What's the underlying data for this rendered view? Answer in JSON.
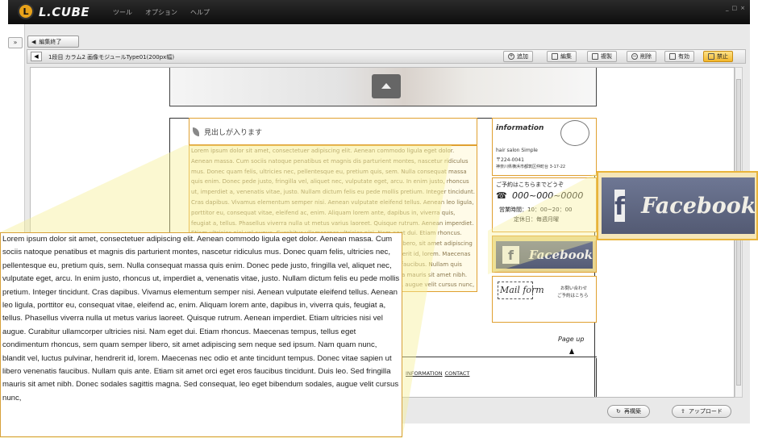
{
  "app": {
    "logo_text": "L.CUBE",
    "logo_mark": "L",
    "menu": [
      "ツール",
      "オプション",
      "ヘルプ"
    ],
    "win_controls": [
      "_",
      "□",
      "×"
    ]
  },
  "panel": {
    "expander": "»",
    "edit_end_label": "編集終了",
    "breadcrumb": "1段目 カラム2 画像モジュールType01(200px幅)",
    "buttons": {
      "add": "追加",
      "edit": "編集",
      "copy": "複製",
      "delete": "削除",
      "enable": "有効",
      "disable": "禁止"
    },
    "rebuild": "再構築",
    "upload": "アップロード"
  },
  "page": {
    "heading": "見出しが入ります",
    "body_text": "Lorem ipsum dolor sit amet, consectetuer adipiscing elit. Aenean commodo ligula eget dolor. Aenean massa. Cum sociis natoque penatibus et magnis dis parturient montes, nascetur ridiculus mus. Donec quam felis, ultricies nec, pellentesque eu, pretium quis, sem. Nulla consequat massa quis enim. Donec pede justo, fringilla vel, aliquet nec, vulputate eget, arcu. In enim justo, rhoncus ut, imperdiet a, venenatis vitae, justo. Nullam dictum felis eu pede mollis pretium. Integer tincidunt. Cras dapibus. Vivamus elementum semper nisi. Aenean vulputate eleifend tellus. Aenean leo ligula, porttitor eu, consequat vitae, eleifend ac, enim. Aliquam lorem ante, dapibus in, viverra quis, feugiat a, tellus. Phasellus viverra nulla ut metus varius laoreet. Quisque rutrum. Aenean imperdiet. Etiam ultricies nisi vel augue. Curabitur ullamcorper ultricies nisi. Nam eget dui. Etiam rhoncus. Maecenas tempus, tellus eget condimentum rhoncus, sem quam semper libero, sit amet adipiscing sem neque sed ipsum. Nam quam nunc, blandit vel, luctus pulvinar, hendrerit id, lorem. Maecenas nec odio et ante tincidunt tempus. Donec vitae sapien ut libero venenatis faucibus. Nullam quis ante. Etiam sit amet orci eget eros faucibus tincidunt. Duis leo. Sed fringilla mauris sit amet nibh. Donec sodales sagittis magna. Sed consequat, leo eget bibendum sodales, augue velit cursus nunc,",
    "info": {
      "title": "information",
      "salon": "hair salon Simple",
      "zip": "〒224-0041",
      "address": "神奈川県横浜市都筑区仲町台 3-17-22"
    },
    "reservation": {
      "title": "ご予約はこちらまでどうぞ",
      "phone": "000~000~0000",
      "hours": "営業時間：10：00~20：00",
      "holiday": "定休日：毎週月曜"
    },
    "facebook": "Facebook",
    "facebook_mark": "f",
    "mail": {
      "title": "Mail form",
      "note_line1": "お問い合わせ",
      "note_line2": "ご予約はこちら"
    },
    "page_up": "Page up",
    "footer_links": [
      "INFORMATION",
      "CONTACT"
    ]
  },
  "zoom": {
    "text": "Lorem ipsum dolor sit amet, consectetuer adipiscing elit. Aenean commodo ligula eget dolor. Aenean massa. Cum sociis natoque penatibus et magnis dis parturient montes, nascetur ridiculus mus. Donec quam felis, ultricies nec, pellentesque eu, pretium quis, sem. Nulla consequat massa quis enim. Donec pede justo, fringilla vel, aliquet nec, vulputate eget, arcu. In enim justo, rhoncus ut, imperdiet a, venenatis vitae, justo. Nullam dictum felis eu pede mollis pretium. Integer tincidunt. Cras dapibus. Vivamus elementum semper nisi. Aenean vulputate eleifend tellus. Aenean leo ligula, porttitor eu, consequat vitae, eleifend ac, enim. Aliquam lorem ante, dapibus in, viverra quis, feugiat a, tellus. Phasellus viverra nulla ut metus varius laoreet. Quisque rutrum. Aenean imperdiet. Etiam ultricies nisi vel augue. Curabitur ullamcorper ultricies nisi. Nam eget dui. Etiam rhoncus. Maecenas tempus, tellus eget condimentum rhoncus, sem quam semper libero, sit amet adipiscing sem neque sed ipsum. Nam quam nunc, blandit vel, luctus pulvinar, hendrerit id, lorem. Maecenas nec odio et ante tincidunt tempus. Donec vitae sapien ut libero venenatis faucibus. Nullam quis ante. Etiam sit amet orci eget eros faucibus tincidunt. Duis leo. Sed fringilla mauris sit amet nibh. Donec sodales sagittis magna. Sed consequat, leo eget bibendum sodales, augue velit cursus nunc,",
    "facebook": "Facebook",
    "facebook_mark": "f"
  },
  "colors": {
    "accent_orange": "#e0a030",
    "highlight_yellow": "#f7ef9a",
    "facebook_slate": "#5f6782"
  }
}
